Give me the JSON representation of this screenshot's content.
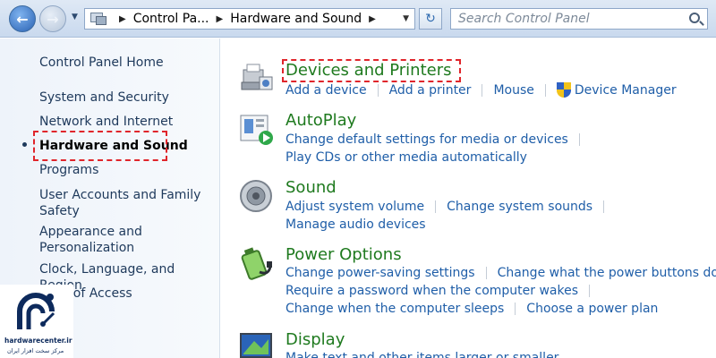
{
  "address_bar": {
    "crumbs": [
      "Control Pa...",
      "Hardware and Sound"
    ],
    "search_placeholder": "Search Control Panel"
  },
  "sidebar": {
    "items": [
      {
        "label": "Control Panel Home"
      },
      {
        "label": "System and Security"
      },
      {
        "label": "Network and Internet"
      },
      {
        "label": "Hardware and Sound",
        "active": true
      },
      {
        "label": "Programs"
      },
      {
        "label": "User Accounts and Family Safety"
      },
      {
        "label": "Appearance and Personalization"
      },
      {
        "label": "Clock, Language, and Region"
      },
      {
        "label": "Ease of Access"
      }
    ]
  },
  "sections": [
    {
      "title": "Devices and Printers",
      "icon": "printer-icon",
      "rows": [
        [
          "Add a device",
          "Add a printer",
          "Mouse",
          "Device Manager"
        ]
      ]
    },
    {
      "title": "AutoPlay",
      "icon": "autoplay-icon",
      "rows": [
        [
          "Change default settings for media or devices"
        ],
        [
          "Play CDs or other media automatically"
        ]
      ]
    },
    {
      "title": "Sound",
      "icon": "speaker-icon",
      "rows": [
        [
          "Adjust system volume",
          "Change system sounds"
        ],
        [
          "Manage audio devices"
        ]
      ]
    },
    {
      "title": "Power Options",
      "icon": "battery-icon",
      "rows": [
        [
          "Change power-saving settings",
          "Change what the power buttons do"
        ],
        [
          "Require a password when the computer wakes"
        ],
        [
          "Change when the computer sleeps",
          "Choose a power plan"
        ]
      ]
    },
    {
      "title": "Display",
      "icon": "display-icon",
      "rows": [
        [
          "Make text and other items larger or smaller"
        ]
      ]
    }
  ],
  "logo": {
    "name": "hardwarecenter.ir",
    "tagline": "مرکز سخت افزار ایران"
  },
  "colors": {
    "link": "#1f5ea8",
    "section_title": "#1f7a1f",
    "highlight": "#e0252b"
  }
}
